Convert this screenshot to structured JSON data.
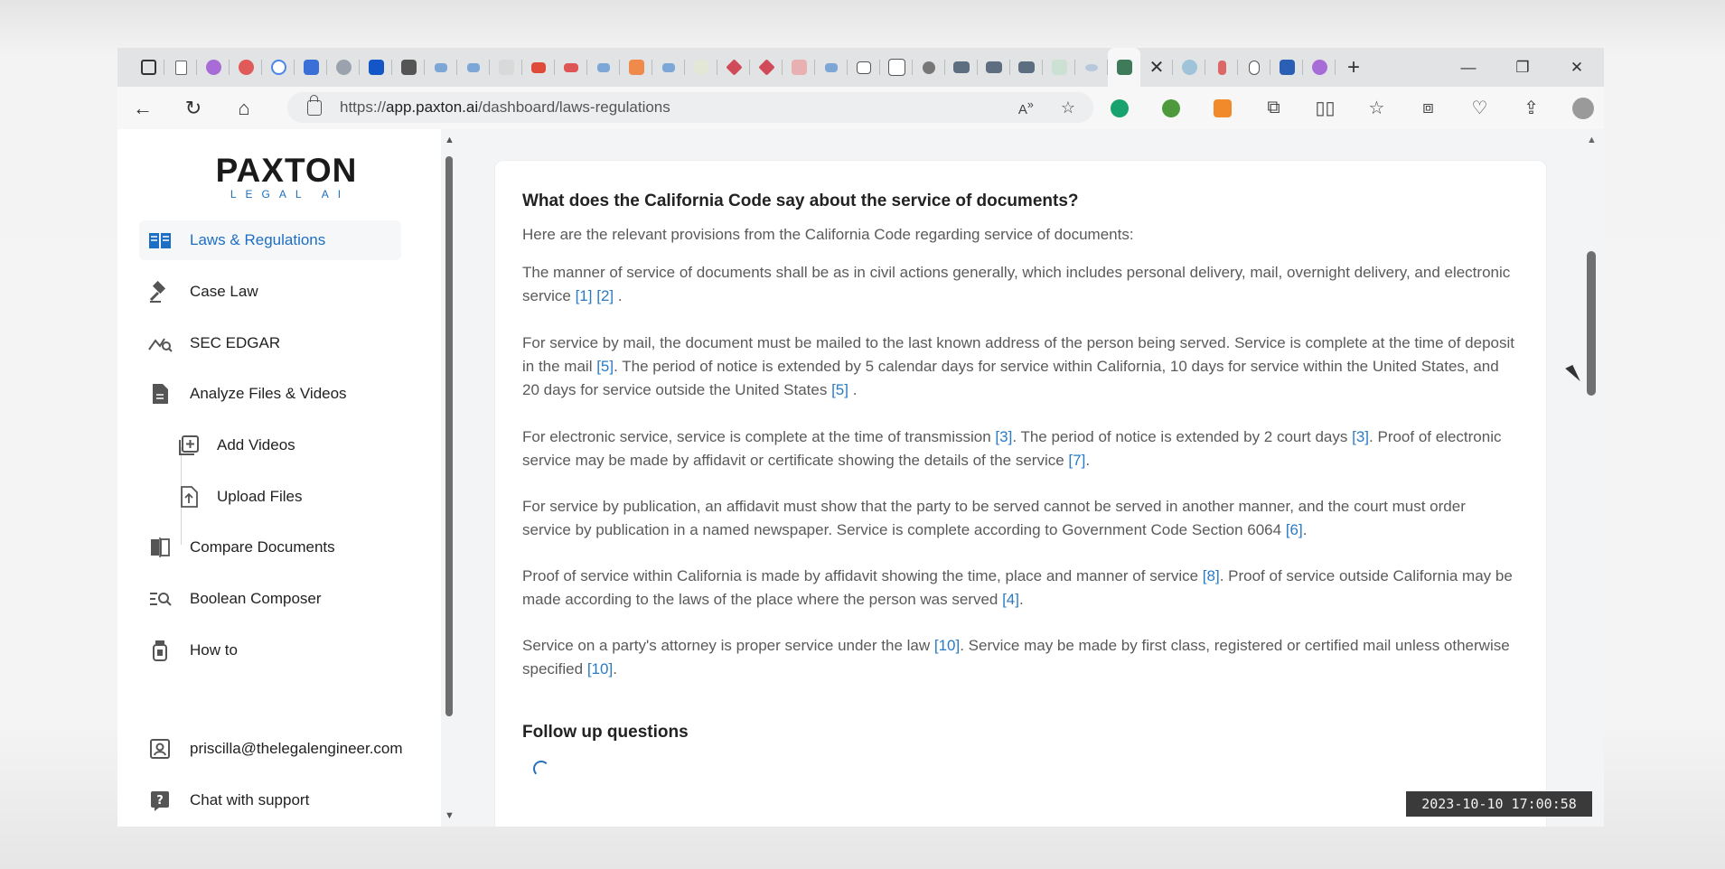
{
  "browser": {
    "address_url_prefix": "https://",
    "address_url_host": "app.paxton.ai",
    "address_url_path": "/dashboard/laws-regulations",
    "tab_close": "✕",
    "new_tab": "+",
    "minimize": "—",
    "restore": "❐",
    "close": "✕"
  },
  "sidebar": {
    "logo_main": "PAXTON",
    "logo_sub": "LEGAL AI",
    "items": [
      {
        "label": "Laws & Regulations"
      },
      {
        "label": "Case Law"
      },
      {
        "label": "SEC EDGAR"
      },
      {
        "label": "Analyze Files & Videos"
      },
      {
        "label": "Add Videos"
      },
      {
        "label": "Upload Files"
      },
      {
        "label": "Compare Documents"
      },
      {
        "label": "Boolean Composer"
      },
      {
        "label": "How to"
      },
      {
        "label": "priscilla@thelegalengineer.com"
      },
      {
        "label": "Chat with support"
      }
    ]
  },
  "main": {
    "question": "What does the California Code say about the service of documents?",
    "intro": "Here are the relevant provisions from the California Code regarding service of documents:",
    "p1": {
      "a": "The manner of service of documents shall be as in civil actions generally, which includes personal delivery, mail, overnight delivery, and electronic service ",
      "c1": "[1]",
      "c2": "[2]",
      "end": "."
    },
    "p2": {
      "a": "For service by mail, the document must be mailed to the last known address of the person being served. Service is complete at the time of deposit in the mail ",
      "c1": "[5]",
      "b": ". The period of notice is extended by 5 calendar days for service within California, 10 days for service within the United States, and 20 days for service outside the United States ",
      "c2": "[5]",
      "end": "."
    },
    "p3": {
      "a": "For electronic service, service is complete at the time of transmission ",
      "c1": "[3]",
      "b": ". The period of notice is extended by 2 court days ",
      "c2": "[3]",
      "c": ". Proof of electronic service may be made by affidavit or certificate showing the details of the service ",
      "c3": "[7]",
      "end": "."
    },
    "p4": {
      "a": "For service by publication, an affidavit must show that the party to be served cannot be served in another manner, and the court must order service by publication in a named newspaper. Service is complete according to Government Code Section 6064 ",
      "c1": "[6]",
      "end": "."
    },
    "p5": {
      "a": "Proof of service within California is made by affidavit showing the time, place and manner of service ",
      "c1": "[8]",
      "b": ". Proof of service outside California may be made according to the laws of the place where the person was served ",
      "c2": "[4]",
      "end": "."
    },
    "p6": {
      "a": "Service on a party's attorney is proper service under the law ",
      "c1": "[10]",
      "b": ". Service may be made by first class, registered or certified mail unless otherwise specified ",
      "c2": "[10]",
      "end": "."
    },
    "followup": "Follow up questions"
  },
  "timestamp": "2023-10-10  17:00:58",
  "colors": {
    "accent": "#1e6fc4",
    "cite": "#2a7bc6"
  }
}
